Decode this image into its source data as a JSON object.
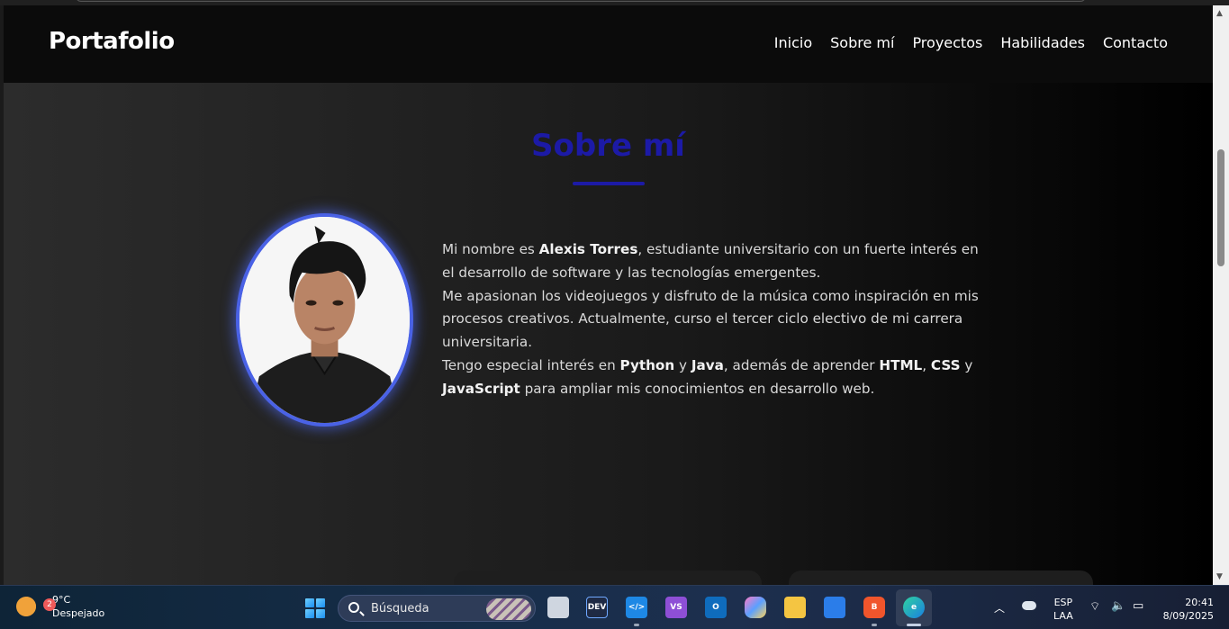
{
  "header": {
    "brand": "Portafolio",
    "nav": [
      "Inicio",
      "Sobre mí",
      "Proyectos",
      "Habilidades",
      "Contacto"
    ]
  },
  "about": {
    "title": "Sobre mí",
    "p1_pre": "Mi nombre es ",
    "name": "Alexis Torres",
    "p1_post": ", estudiante universitario con un fuerte interés en el desarrollo de software y las tecnologías emergentes.",
    "p2": "Me apasionan los videojuegos y disfruto de la música como inspiración en mis procesos creativos. Actualmente, curso el tercer ciclo electivo de mi carrera universitaria.",
    "p3_pre": "Tengo especial interés en ",
    "lang1": "Python",
    "and1": " y ",
    "lang2": "Java",
    "p3_mid": ", además de aprender ",
    "lang3": "HTML",
    "comma": ", ",
    "lang4": "CSS",
    "and2": " y ",
    "lang5": "JavaScript",
    "p3_post": " para ampliar mis conocimientos en desarrollo web."
  },
  "colors": {
    "accent": "#1c1aa6",
    "photo_border": "#4a62e6"
  },
  "taskbar": {
    "weather_badge": "2",
    "temperature": "9°C",
    "condition": "Despejado",
    "search_placeholder": "Búsqueda",
    "app_icons": [
      "start-icon",
      "task-view-icon",
      "dev-home-icon",
      "vscode-icon",
      "visual-studio-icon",
      "outlook-icon",
      "copilot-icon",
      "file-explorer-icon",
      "store-icon",
      "brave-icon",
      "edge-icon"
    ],
    "lang_line1": "ESP",
    "lang_line2": "LAA",
    "time": "20:41",
    "date": "8/09/2025"
  }
}
